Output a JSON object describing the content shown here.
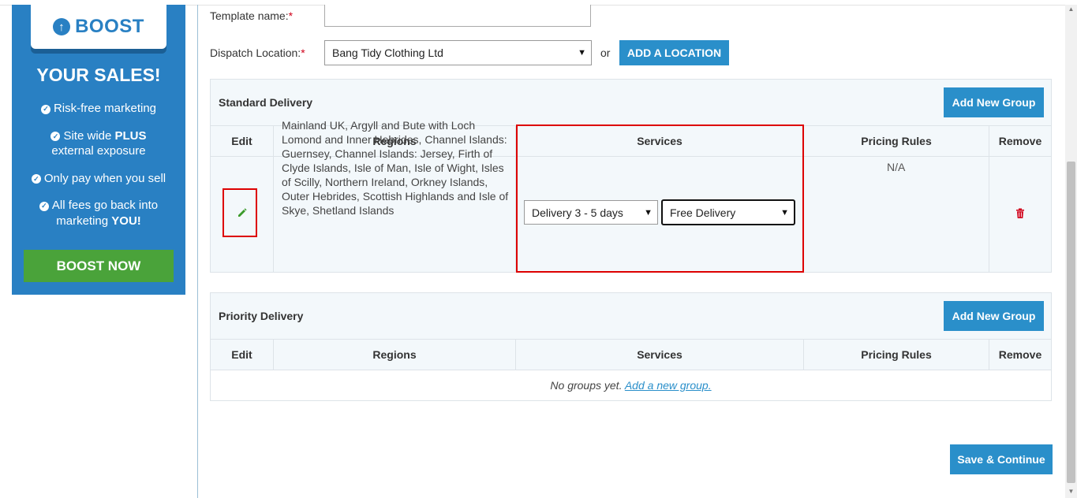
{
  "boost": {
    "badge": "BOOST",
    "title": "YOUR SALES!",
    "features": [
      {
        "pre": "Risk-free marketing",
        "bold": "",
        "post": ""
      },
      {
        "pre": "Site wide ",
        "bold": "PLUS",
        "post": " external exposure"
      },
      {
        "pre": "Only pay when you sell",
        "bold": "",
        "post": ""
      },
      {
        "pre": "All fees go back into marketing ",
        "bold": "YOU!",
        "post": ""
      }
    ],
    "button": "BOOST NOW"
  },
  "form": {
    "template_label": "Template name:",
    "template_value": "",
    "dispatch_label": "Dispatch Location:",
    "required_mark": "*",
    "dispatch_value": "Bang Tidy Clothing Ltd",
    "or_text": "or",
    "add_location": "ADD A LOCATION"
  },
  "standard": {
    "title": "Standard Delivery",
    "add_group": "Add New Group",
    "headers": {
      "edit": "Edit",
      "regions": "Regions",
      "services": "Services",
      "pricing": "Pricing Rules",
      "remove": "Remove"
    },
    "row": {
      "regions": "Mainland UK, Argyll and Bute with Loch Lomond and Inner Hebrides, Channel Islands: Guernsey, Channel Islands: Jersey, Firth of Clyde Islands, Isle of Man, Isle of Wight, Isles of Scilly, Northern Ireland, Orkney Islands, Outer Hebrides, Scottish Highlands and Isle of Skye, Shetland Islands",
      "service": "Delivery 3 - 5 days",
      "pricing_select": "Free Delivery",
      "pricing_rules": "N/A"
    }
  },
  "priority": {
    "title": "Priority Delivery",
    "add_group": "Add New Group",
    "headers": {
      "edit": "Edit",
      "regions": "Regions",
      "services": "Services",
      "pricing": "Pricing Rules",
      "remove": "Remove"
    },
    "empty_text": "No groups yet.",
    "empty_link": "Add a new group."
  },
  "save_button": "Save & Continue",
  "colors": {
    "primary": "#2a8fca",
    "boost_bg": "#2980c3",
    "boost_btn": "#4aa33a",
    "highlight": "#dd0000",
    "trash": "#d0021b",
    "pencil": "#3a9a2a"
  }
}
